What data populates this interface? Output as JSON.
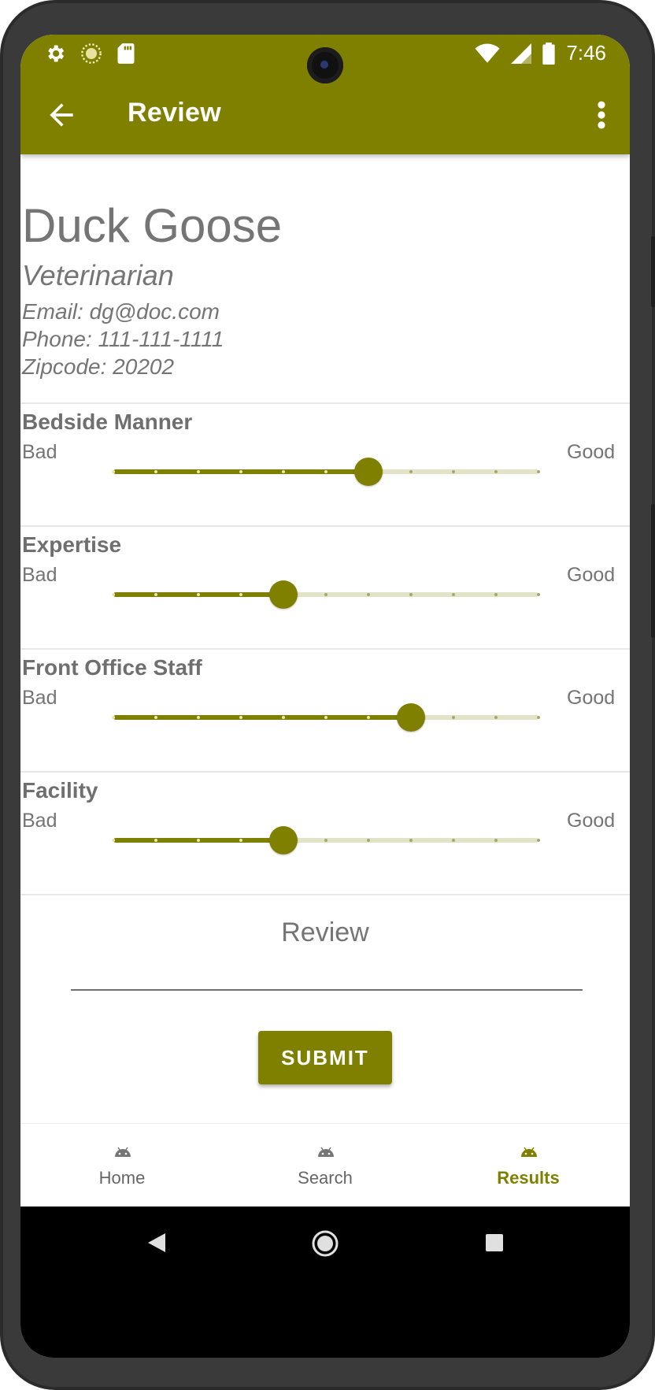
{
  "status_bar": {
    "time": "7:46",
    "left_icons": [
      "settings-icon",
      "sync-icon",
      "sd-card-icon"
    ],
    "right_icons": [
      "wifi-icon",
      "signal-icon",
      "battery-icon"
    ]
  },
  "app_bar": {
    "title": "Review",
    "back_icon": "arrow-back-icon",
    "menu_icon": "more-vert-icon"
  },
  "doctor": {
    "name": "Duck Goose",
    "specialty": "Veterinarian",
    "email": "Email: dg@doc.com",
    "phone": "Phone: 111-111-1111",
    "zipcode": "Zipcode: 20202"
  },
  "ratings": [
    {
      "title": "Bedside Manner",
      "low_label": "Bad",
      "high_label": "Good",
      "value": 6,
      "max": 10
    },
    {
      "title": "Expertise",
      "low_label": "Bad",
      "high_label": "Good",
      "value": 4,
      "max": 10
    },
    {
      "title": "Front Office Staff",
      "low_label": "Bad",
      "high_label": "Good",
      "value": 7,
      "max": 10
    },
    {
      "title": "Facility",
      "low_label": "Bad",
      "high_label": "Good",
      "value": 4,
      "max": 10
    }
  ],
  "review": {
    "label": "Review",
    "value": "",
    "submit_label": "SUBMIT"
  },
  "bottom_nav": {
    "items": [
      {
        "label": "Home",
        "icon": "android-icon",
        "active": false
      },
      {
        "label": "Search",
        "icon": "android-icon",
        "active": false
      },
      {
        "label": "Results",
        "icon": "android-icon",
        "active": true
      }
    ]
  },
  "colors": {
    "primary": "#808000",
    "track_inactive": "#e3e4c7",
    "text_gray": "#757575"
  }
}
